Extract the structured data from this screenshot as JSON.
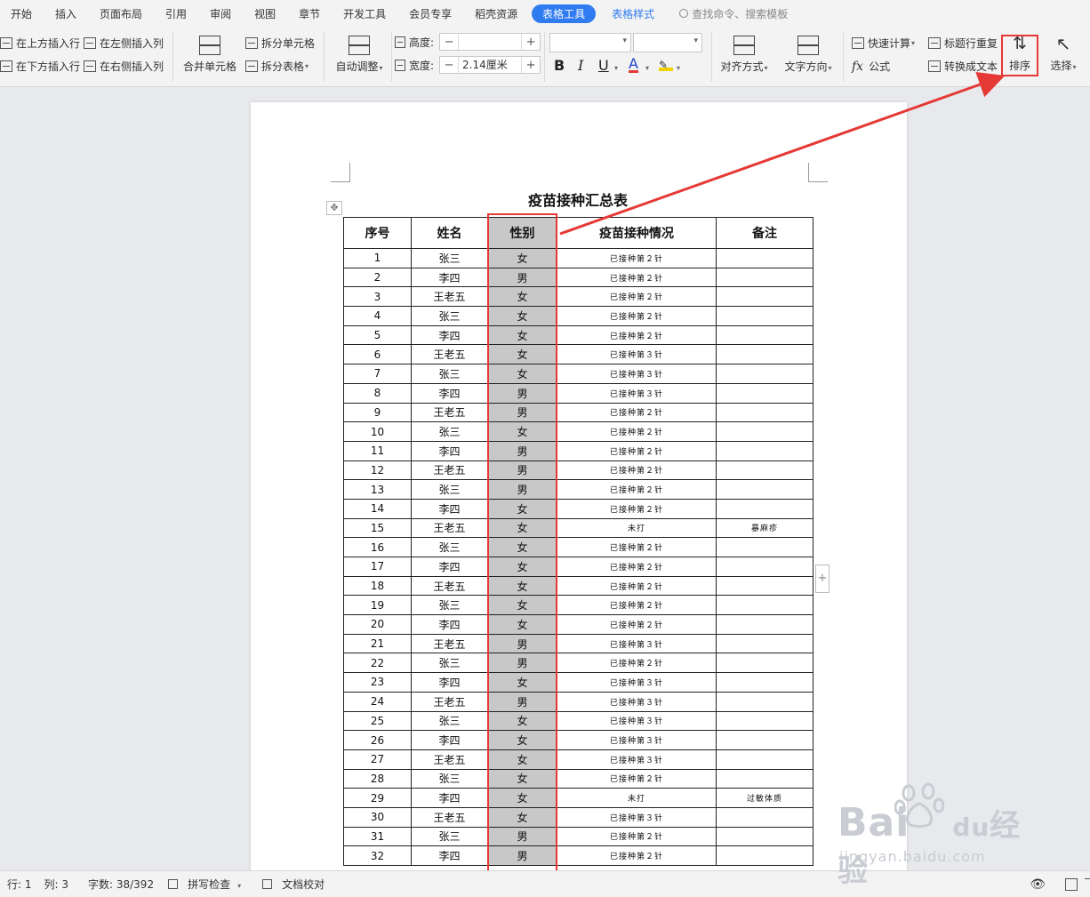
{
  "menu": {
    "tabs": [
      "开始",
      "插入",
      "页面布局",
      "引用",
      "审阅",
      "视图",
      "章节",
      "开发工具",
      "会员专享",
      "稻壳资源"
    ],
    "active_tab": "表格工具",
    "style_tab": "表格样式",
    "search_placeholder": "查找命令、搜索模板"
  },
  "ribbon": {
    "insert_above": "在上方插入行",
    "insert_below": "在下方插入行",
    "insert_left": "在左侧插入列",
    "insert_right": "在右侧插入列",
    "merge_cells": "合并单元格",
    "split_cells": "拆分单元格",
    "split_table": "拆分表格",
    "auto_fit": "自动调整",
    "height_label": "高度:",
    "height_value": "",
    "width_label": "宽度:",
    "width_value": "2.14厘米",
    "align": "对齐方式",
    "text_direction": "文字方向",
    "quick_calc": "快速计算",
    "header_repeat": "标题行重复",
    "formula": "公式",
    "convert_text": "转换成文本",
    "sort": "排序",
    "select": "选择",
    "bold": "B",
    "italic": "I",
    "underline": "U",
    "font_color": "A",
    "minus": "−",
    "plus": "+"
  },
  "document": {
    "title": "疫苗接种汇总表",
    "headers": [
      "序号",
      "姓名",
      "性别",
      "疫苗接种情况",
      "备注"
    ],
    "rows": [
      [
        "1",
        "张三",
        "女",
        "已接种第２针",
        ""
      ],
      [
        "2",
        "李四",
        "男",
        "已接种第２针",
        ""
      ],
      [
        "3",
        "王老五",
        "女",
        "已接种第２针",
        ""
      ],
      [
        "4",
        "张三",
        "女",
        "已接种第２针",
        ""
      ],
      [
        "5",
        "李四",
        "女",
        "已接种第２针",
        ""
      ],
      [
        "6",
        "王老五",
        "女",
        "已接种第３针",
        ""
      ],
      [
        "7",
        "张三",
        "女",
        "已接种第３针",
        ""
      ],
      [
        "8",
        "李四",
        "男",
        "已接种第３针",
        ""
      ],
      [
        "9",
        "王老五",
        "男",
        "已接种第２针",
        ""
      ],
      [
        "10",
        "张三",
        "女",
        "已接种第２针",
        ""
      ],
      [
        "11",
        "李四",
        "男",
        "已接种第２针",
        ""
      ],
      [
        "12",
        "王老五",
        "男",
        "已接种第２针",
        ""
      ],
      [
        "13",
        "张三",
        "男",
        "已接种第２针",
        ""
      ],
      [
        "14",
        "李四",
        "女",
        "已接种第２针",
        ""
      ],
      [
        "15",
        "王老五",
        "女",
        "未打",
        "暴麻疹"
      ],
      [
        "16",
        "张三",
        "女",
        "已接种第２针",
        ""
      ],
      [
        "17",
        "李四",
        "女",
        "已接种第２针",
        ""
      ],
      [
        "18",
        "王老五",
        "女",
        "已接种第２针",
        ""
      ],
      [
        "19",
        "张三",
        "女",
        "已接种第２针",
        ""
      ],
      [
        "20",
        "李四",
        "女",
        "已接种第２针",
        ""
      ],
      [
        "21",
        "王老五",
        "男",
        "已接种第３针",
        ""
      ],
      [
        "22",
        "张三",
        "男",
        "已接种第２针",
        ""
      ],
      [
        "23",
        "李四",
        "女",
        "已接种第３针",
        ""
      ],
      [
        "24",
        "王老五",
        "男",
        "已接种第３针",
        ""
      ],
      [
        "25",
        "张三",
        "女",
        "已接种第３针",
        ""
      ],
      [
        "26",
        "李四",
        "女",
        "已接种第３针",
        ""
      ],
      [
        "27",
        "王老五",
        "女",
        "已接种第３针",
        ""
      ],
      [
        "28",
        "张三",
        "女",
        "已接种第２针",
        ""
      ],
      [
        "29",
        "李四",
        "女",
        "未打",
        "过敏体质"
      ],
      [
        "30",
        "王老五",
        "女",
        "已接种第３针",
        ""
      ],
      [
        "31",
        "张三",
        "男",
        "已接种第２针",
        ""
      ],
      [
        "32",
        "李四",
        "男",
        "已接种第２针",
        ""
      ]
    ]
  },
  "status": {
    "row": "行: 1",
    "col": "列: 3",
    "words": "字数: 38/392",
    "spell": "拼写检查",
    "proof": "文档校对"
  },
  "watermark": {
    "brand_a": "Bai",
    "brand_b": "du",
    "brand_c": "经验",
    "url": "jingyan.baidu.com"
  },
  "colors": {
    "accent": "#2f7bf0",
    "highlight": "#e53935",
    "selected_column": "#c8c8c8"
  }
}
